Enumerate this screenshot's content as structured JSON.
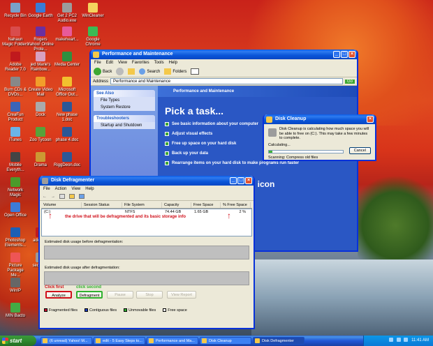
{
  "desktop": {
    "icons": [
      {
        "label": "Recycle Bin",
        "color": "#7aa0c8"
      },
      {
        "label": "Google Earth",
        "color": "#3a7bd5"
      },
      {
        "label": "Get 2 PC2 Audio.exe",
        "color": "#9c9c9c"
      },
      {
        "label": "WinCleaner",
        "color": "#f4d35e"
      },
      {
        "label": "Nahaun Magic Folders",
        "color": "#d94c4c"
      },
      {
        "label": "Rogers Yahoo! Online Prote...",
        "color": "#6b2fa0"
      },
      {
        "label": "makeheart...",
        "color": "#e85a9a"
      },
      {
        "label": "Google Chrome",
        "color": "#3cba54"
      },
      {
        "label": "Adobe Reader 7.0",
        "color": "#c0191d"
      },
      {
        "label": "jed Marie's Rainbow...",
        "color": "#d8a0c0"
      },
      {
        "label": "Media Center",
        "color": "#2f8f3f"
      },
      {
        "label": "Burn CDs & DVDs...",
        "color": "#888"
      },
      {
        "label": "Create Video Mail",
        "color": "#f29e2a"
      },
      {
        "label": "Microsoft Office Out...",
        "color": "#f2c12e"
      },
      {
        "label": "CreaFun Product",
        "color": "#3b64b8"
      },
      {
        "label": "Dock",
        "color": "#aaa"
      },
      {
        "label": "New phase 1.doc",
        "color": "#2b5797"
      },
      {
        "label": "iTunes",
        "color": "#6bb4e8"
      },
      {
        "label": "Zoo Tycoon",
        "color": "#57a23a"
      },
      {
        "label": "phase 4.doc",
        "color": "#2b5797"
      },
      {
        "label": "Mobile Everyth...",
        "color": "#444"
      },
      {
        "label": "Drama",
        "color": "#c93"
      },
      {
        "label": "RiggDeon.doc",
        "color": "#2b5797"
      },
      {
        "label": "Network Magic",
        "color": "#4c9a2a"
      },
      {
        "label": "Open Office",
        "color": "#3d7bd8"
      },
      {
        "label": "Photoshop Elements...",
        "color": "#1d5fb5"
      },
      {
        "label": "adobe...",
        "color": "#c0191d"
      },
      {
        "label": "Picture Package Me...",
        "color": "#e55"
      },
      {
        "label": "sedunao",
        "color": "#999"
      },
      {
        "label": "WinIP",
        "color": "#666"
      },
      {
        "label": "MIN Bacto",
        "color": "#4a4"
      }
    ]
  },
  "perf_window": {
    "title": "Performance and Maintenance",
    "menu": [
      "File",
      "Edit",
      "View",
      "Favorites",
      "Tools",
      "Help"
    ],
    "toolbar": {
      "back": "Back",
      "search": "Search",
      "folders": "Folders"
    },
    "address_label": "Address",
    "address_value": "Performance and Maintenance",
    "go": "Go",
    "see_also": {
      "title": "See Also",
      "items": [
        "File Types",
        "System Restore"
      ]
    },
    "troubleshooters": {
      "title": "Troubleshooters",
      "items": [
        "Startup and Shutdown"
      ]
    },
    "band_title": "Performance and Maintenance",
    "heading": "Pick a task...",
    "tasks": [
      "See basic information about your computer",
      "Adjust visual effects",
      "Free up space on your hard disk",
      "Back up your data",
      "Rearrange items on your hard disk to make programs run faster"
    ],
    "partial_heading": "nel icon",
    "partial_options": "ptions"
  },
  "cleanup": {
    "title": "Disk Cleanup",
    "message": "Disk Cleanup is calculating how much space you will be able to free on (C:). This may take a few minutes to complete.",
    "calculating": "Calculating...",
    "cancel": "Cancel",
    "progress": 0.05,
    "scanning_label": "Scanning:",
    "scanning_value": "Compress old files"
  },
  "defrag": {
    "title": "Disk Defragmenter",
    "menu": [
      "File",
      "Action",
      "View",
      "Help"
    ],
    "columns": [
      "Volume",
      "Session Status",
      "File System",
      "Capacity",
      "Free Space",
      "% Free Space"
    ],
    "row": {
      "volume": "(C:)",
      "status": "",
      "fs": "NTFS",
      "capacity": "74.44 GB",
      "free": "1.65 GB",
      "pct": "2 %"
    },
    "annotation": "the drive that will be defragmented and its basic storage info",
    "before_label": "Estimated disk usage before defragmentation:",
    "after_label": "Estimated disk usage after defragmentation:",
    "click_first": "Click first",
    "click_second": "click second",
    "buttons": {
      "analyze": "Analyze",
      "defragment": "Defragment",
      "pause": "Pause",
      "stop": "Stop",
      "view_report": "View Report"
    },
    "legend": [
      {
        "label": "Fragmented files",
        "color": "#c8102e"
      },
      {
        "label": "Contiguous files",
        "color": "#1f3fbf"
      },
      {
        "label": "Unmovable files",
        "color": "#2fb12f"
      },
      {
        "label": "Free space",
        "color": "#ffffff"
      }
    ]
  },
  "taskbar": {
    "start": "start",
    "items": [
      "(6 unread) Yahoo! M...",
      "edit - 5 Easy Steps to...",
      "Performance and Ma...",
      "Disk Cleanup",
      "Disk Defragmenter"
    ],
    "clock": "11:41 AM"
  }
}
